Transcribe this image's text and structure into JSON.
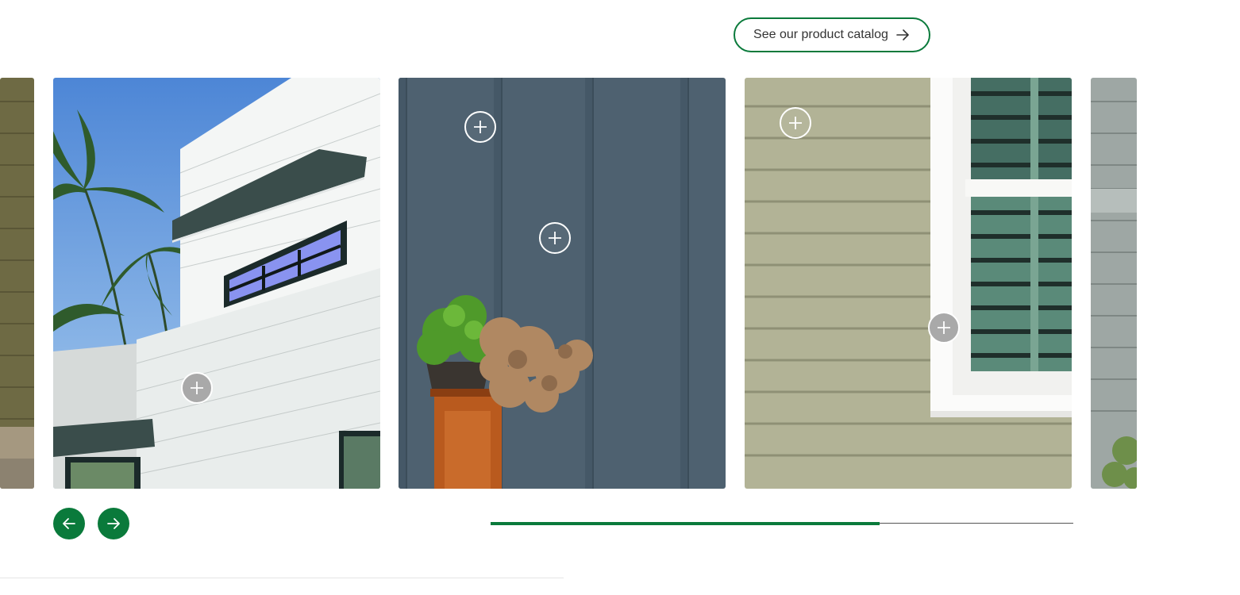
{
  "catalog": {
    "label": "See our product catalog",
    "icon": "arrow-right-icon"
  },
  "colors": {
    "accent": "#0a7a3b"
  },
  "carousel": {
    "cards": [
      {
        "name": "partial-previous-card"
      },
      {
        "name": "white-modern-siding-card"
      },
      {
        "name": "blue-board-and-batten-card"
      },
      {
        "name": "sage-lap-siding-card"
      },
      {
        "name": "partial-next-card"
      }
    ],
    "prev_icon": "arrow-left-icon",
    "next_icon": "arrow-right-icon",
    "progress": 0.667
  }
}
